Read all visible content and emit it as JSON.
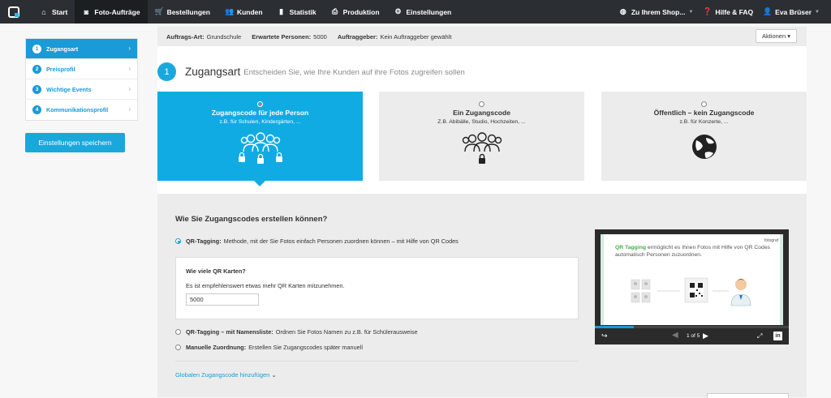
{
  "nav": {
    "items": [
      {
        "label": "Start",
        "icon": "home-icon"
      },
      {
        "label": "Foto-Aufträge",
        "icon": "camera-icon"
      },
      {
        "label": "Bestellungen",
        "icon": "cart-icon"
      },
      {
        "label": "Kunden",
        "icon": "users-icon"
      },
      {
        "label": "Statistik",
        "icon": "bar-chart-icon"
      },
      {
        "label": "Produktion",
        "icon": "printer-icon"
      },
      {
        "label": "Einstellungen",
        "icon": "gear-icon"
      }
    ],
    "shop_label": "Zu Ihrem Shop...",
    "help_label": "Hilfe & FAQ",
    "user_label": "Eva Brüser"
  },
  "sidebar": {
    "items": [
      {
        "num": "1",
        "label": "Zugangsart"
      },
      {
        "num": "2",
        "label": "Preisprofil"
      },
      {
        "num": "3",
        "label": "Wichtige Events"
      },
      {
        "num": "4",
        "label": "Kommunikationsprofil"
      }
    ],
    "save_label": "Einstellungen speichern"
  },
  "infobar": {
    "order_type_label": "Auftrags-Art:",
    "order_type_value": "Grundschule",
    "persons_label": "Erwartete Personen:",
    "persons_value": "5000",
    "client_label": "Auftraggeber:",
    "client_value": "Kein Auftraggeber gewählt",
    "actions_label": "Aktionen ▾"
  },
  "section": {
    "num": "1",
    "title": "Zugangsart",
    "subtitle": "Entscheiden Sie, wie Ihre Kunden auf ihre Fotos zugreifen sollen"
  },
  "cards": [
    {
      "title": "Zugangscode für jede Person",
      "subtitle": "z.B. für Schulen, Kindergärten, ..."
    },
    {
      "title": "Ein Zugangscode",
      "subtitle": "Z.B. Abibälle, Studio, Hochzeiten, ..."
    },
    {
      "title": "Öffentlich – kein Zugangscode",
      "subtitle": "z.B. für Konzerte, ..."
    }
  ],
  "lower": {
    "heading": "Wie Sie Zugangscodes erstellen können?",
    "options": [
      {
        "bold": "QR-Tagging:",
        "text": "Methode, mit der Sie Fotos einfach Personen zuordnen können – mit Hilfe von QR Codes"
      },
      {
        "bold": "QR-Tagging – mit Namensliste:",
        "text": "Ordnen Sie Fotos Namen zu z.B. für Schülerausweise"
      },
      {
        "bold": "Manuelle Zuordnung:",
        "text": "Erstellen Sie Zugangscodes später manuell"
      }
    ],
    "qr_question": "Wie viele QR Karten?",
    "qr_hint": "Es ist empfehlenswert etwas mehr QR Karten mitzunehmen.",
    "qr_value": "5000",
    "global_link": "Globalen Zugangscode hinzufügen"
  },
  "video": {
    "brand": "fotograf",
    "highlight": "QR Tagging",
    "text": "ermöglicht es Ihnen Fotos mit Hilfe von QR Codes automatisch Personen zuzuordnen.",
    "page": "1 of 5",
    "linkedin": "in"
  },
  "colors": {
    "accent": "#1aa8dc",
    "nav_bg": "#2b2f33"
  }
}
